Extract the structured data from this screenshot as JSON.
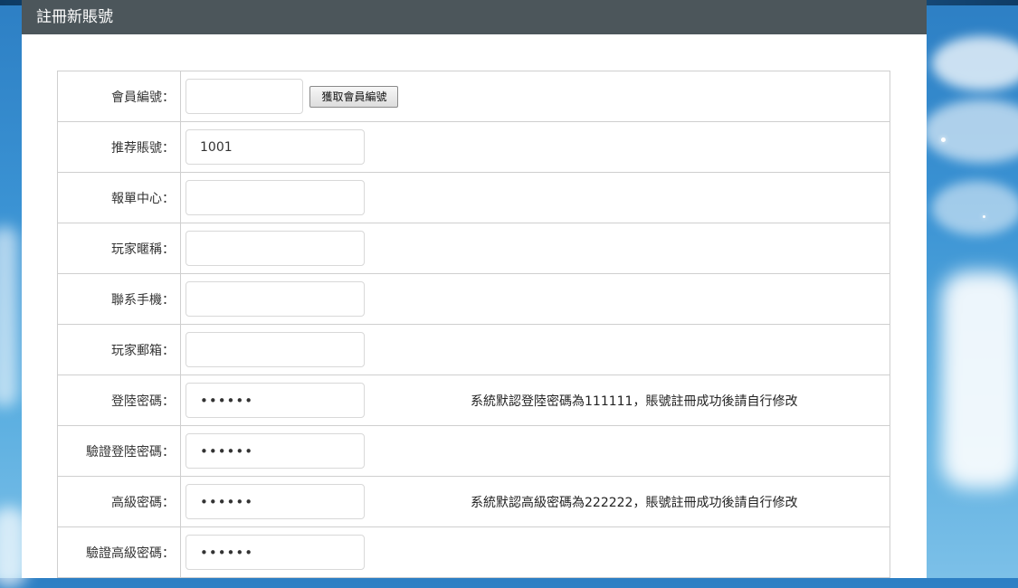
{
  "header": {
    "title": "註冊新賬號"
  },
  "form": {
    "get_id_button": "獲取會員編號",
    "rows": [
      {
        "label": "會員編號：",
        "value": "",
        "type": "text"
      },
      {
        "label": "推荐賬號：",
        "value": "1001",
        "type": "text"
      },
      {
        "label": "報單中心：",
        "value": "",
        "type": "text"
      },
      {
        "label": "玩家暱稱：",
        "value": "",
        "type": "text"
      },
      {
        "label": "聯系手機：",
        "value": "",
        "type": "text"
      },
      {
        "label": "玩家郵箱：",
        "value": "",
        "type": "text"
      },
      {
        "label": "登陸密碼：",
        "value": "111111",
        "type": "password",
        "hint": "系統默認登陸密碼為111111，賬號註冊成功後請自行修改"
      },
      {
        "label": "驗證登陸密碼：",
        "value": "111111",
        "type": "password"
      },
      {
        "label": "高級密碼：",
        "value": "222222",
        "type": "password",
        "hint": "系統默認高級密碼為222222，賬號註冊成功後請自行修改"
      },
      {
        "label": "驗證高級密碼：",
        "value": "222222",
        "type": "password"
      }
    ]
  }
}
